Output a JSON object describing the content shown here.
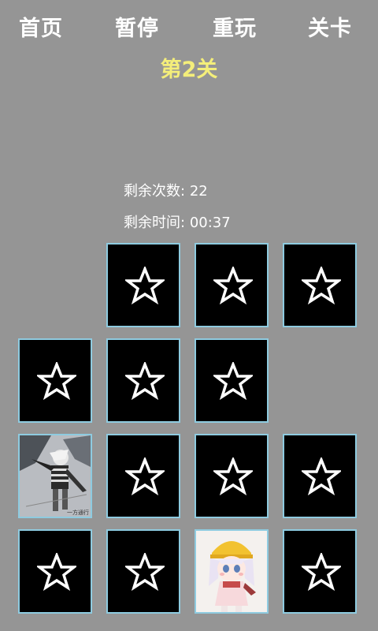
{
  "nav": {
    "home": "首页",
    "pause": "暂停",
    "replay": "重玩",
    "levels": "关卡"
  },
  "level_title": "第2关",
  "stats": {
    "remaining_attempts_label": "剩余次数:",
    "remaining_attempts_value": "22",
    "remaining_time_label": "剩余时间:",
    "remaining_time_value": "00:37"
  },
  "cards": {
    "back_icon": "star-icon",
    "revealed_1": "anime character in striped shirt holding scythe",
    "revealed_2": "chibi anime girl with yellow hat",
    "revealed_1_caption": "一方通行"
  },
  "colors": {
    "background": "#959595",
    "title": "#f4ee7a",
    "card_border": "#8ecbe0",
    "card_back": "#000000"
  }
}
